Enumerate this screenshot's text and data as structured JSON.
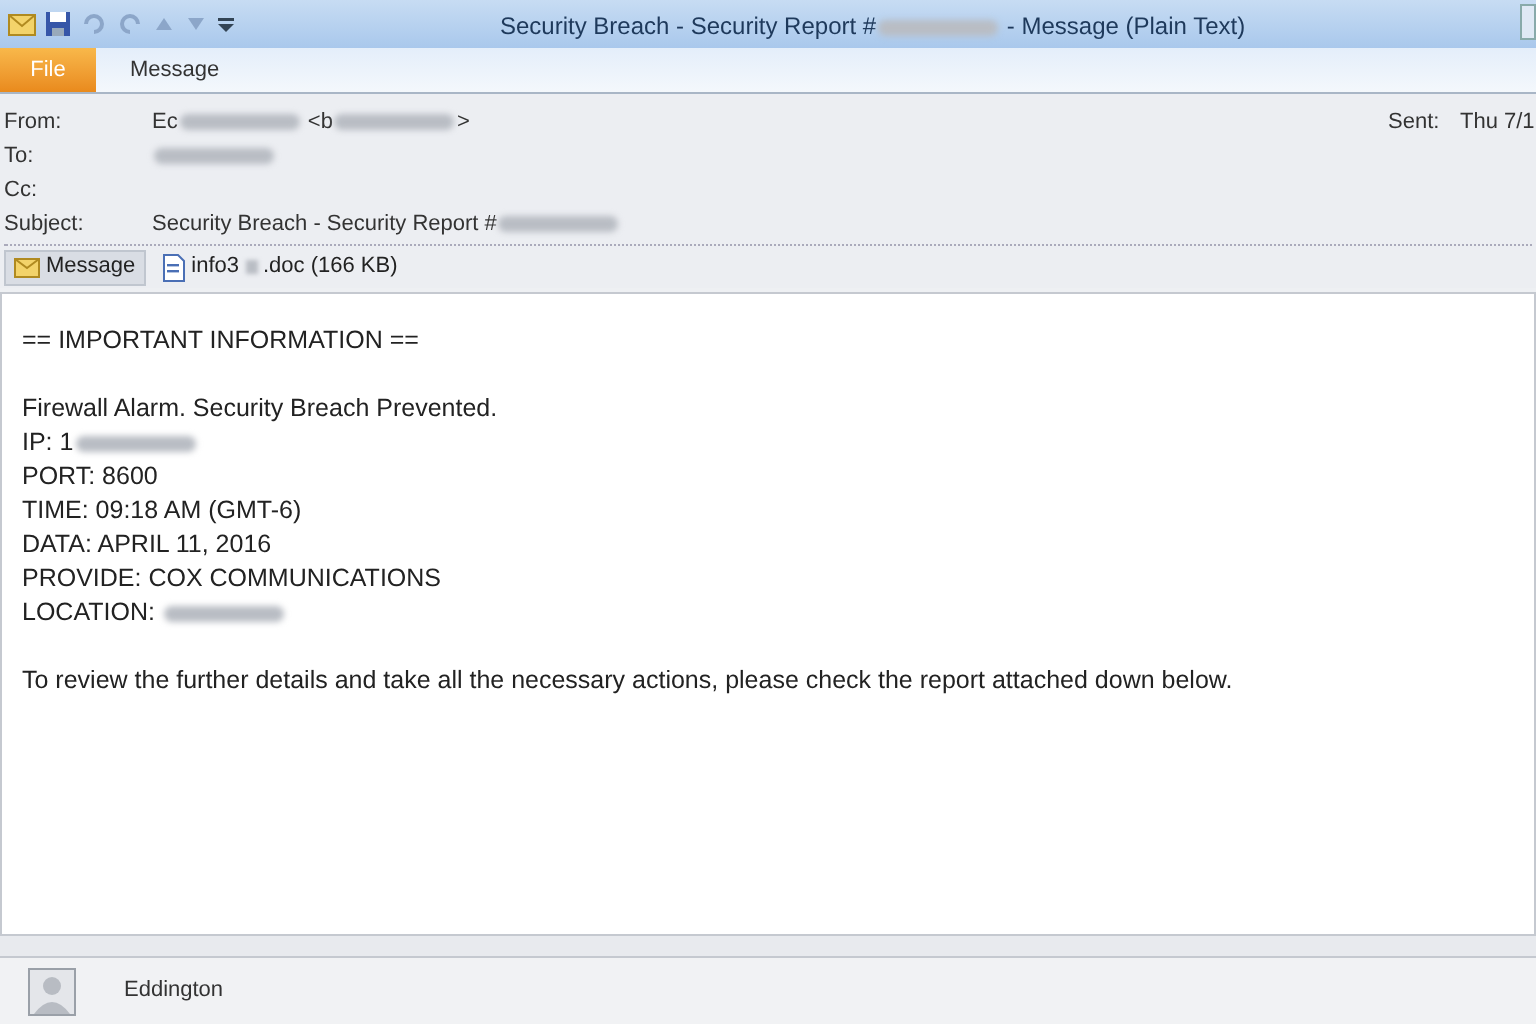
{
  "window": {
    "title": [
      {
        "kind": "text",
        "text": "Security Breach - Security Report #"
      },
      {
        "kind": "blur"
      },
      {
        "kind": "text",
        "text": " - Message (Plain Text)"
      }
    ]
  },
  "ribbon_tabs": [
    {
      "label": "File",
      "selected": true
    },
    {
      "label": "Message",
      "selected": false
    }
  ],
  "header": {
    "from_label": "From:",
    "from": [
      {
        "kind": "text",
        "text": "Ec"
      },
      {
        "kind": "blur"
      },
      {
        "kind": "text",
        "text": " <b"
      },
      {
        "kind": "blur"
      },
      {
        "kind": "text",
        "text": ">"
      }
    ],
    "to_label": "To:",
    "to": [
      {
        "kind": "blur"
      }
    ],
    "cc_label": "Cc:",
    "subject_label": "Subject:",
    "subject": [
      {
        "kind": "text",
        "text": "Security Breach - Security Report #"
      },
      {
        "kind": "blur"
      }
    ],
    "sent_label": "Sent:",
    "sent": "Thu 7/1"
  },
  "attachments": [
    {
      "label": [
        {
          "kind": "text",
          "text": "Message"
        }
      ],
      "selected": true,
      "kind": "envelope"
    },
    {
      "label": [
        {
          "kind": "text",
          "text": "info3"
        },
        {
          "kind": "blur"
        },
        {
          "kind": "text",
          "text": ".doc (166 KB)"
        }
      ],
      "selected": false,
      "kind": "doc"
    }
  ],
  "body": [
    [
      [
        {
          "kind": "text",
          "text": "== IMPORTANT INFORMATION =="
        }
      ]
    ],
    [
      [
        {
          "kind": "text",
          "text": "Firewall Alarm. Security Breach Prevented."
        }
      ],
      [
        {
          "kind": "text",
          "text": "IP: 1"
        },
        {
          "kind": "blur"
        }
      ],
      [
        {
          "kind": "text",
          "text": "PORT: 8600"
        }
      ],
      [
        {
          "kind": "text",
          "text": "TIME: 09:18 AM (GMT-6)"
        }
      ],
      [
        {
          "kind": "text",
          "text": "DATA: APRIL 11, 2016"
        }
      ],
      [
        {
          "kind": "text",
          "text": "PROVIDE: COX COMMUNICATIONS"
        }
      ],
      [
        {
          "kind": "text",
          "text": "LOCATION: "
        },
        {
          "kind": "blur"
        }
      ]
    ],
    [
      [
        {
          "kind": "text",
          "text": "To review the further details and take all the necessary actions, please check the report attached down below."
        }
      ]
    ]
  ],
  "people_pane": {
    "name": "Eddington"
  }
}
